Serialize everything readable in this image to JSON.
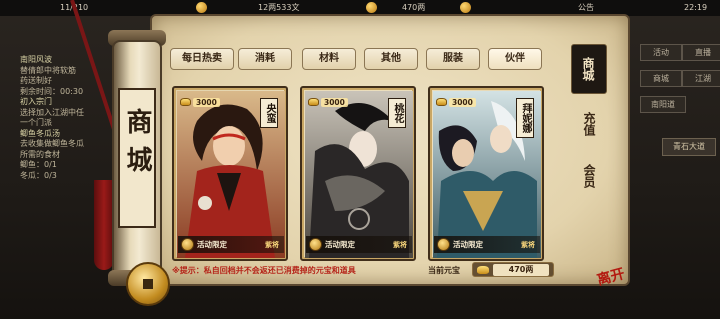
{
  "status_bar": {
    "left_partial": "11/210",
    "currency_copper": "12两533文",
    "currency_silver": "470两",
    "announcement": "公告",
    "clock": "22:19"
  },
  "quest_panel": {
    "items": [
      {
        "title": "南阳风波",
        "lines": [
          "替倩郎中将软筋",
          "药送制好",
          "剩余时间：00:30"
        ]
      },
      {
        "title": "初入宗门",
        "lines": [
          "选择加入江湖中任",
          "一个门派"
        ]
      },
      {
        "title": "鲫鱼冬瓜汤",
        "lines": [
          "去收集做鲫鱼冬瓜",
          "所需的食材",
          "鲫鱼：0/1",
          "冬瓜：0/3"
        ]
      }
    ]
  },
  "right_menu": {
    "buttons": [
      "活动",
      "直播",
      "商城",
      "江湖"
    ],
    "location_label": "南阳道",
    "road_label": "青石大道"
  },
  "shop": {
    "title": "商城",
    "tabs": [
      "每日热卖",
      "消耗",
      "材料",
      "其他",
      "服装",
      "伙伴"
    ],
    "active_tab": "伙伴",
    "side_tabs": [
      "商城",
      "充值",
      "会员"
    ],
    "active_side_tab": "商城",
    "cards": [
      {
        "name": "央蛮",
        "price": "3000",
        "tag": "活动限定",
        "rarity": "紫将",
        "theme": "red"
      },
      {
        "name": "桃花",
        "price": "3000",
        "tag": "活动限定",
        "rarity": "紫将",
        "theme": "gray"
      },
      {
        "name": "拜妮娜",
        "price": "3000",
        "tag": "活动限定",
        "rarity": "紫将",
        "theme": "gold"
      }
    ],
    "tip": "※提示：私自回档并不会返还已消费掉的元宝和道具",
    "balance_label": "当前元宝",
    "balance_value": "470两",
    "exit_label": "离开"
  },
  "colors": {
    "paper": "#efe3c5",
    "frame": "#402e1a",
    "tip_red": "#b5251a",
    "gold": "#c98e1a"
  }
}
